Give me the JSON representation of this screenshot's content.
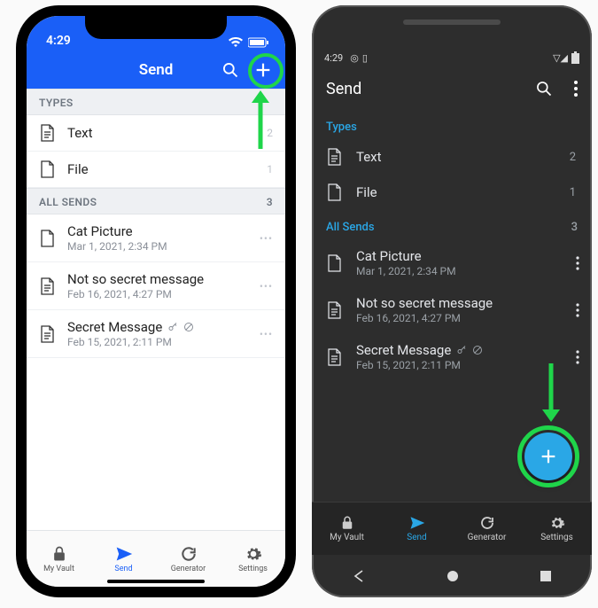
{
  "ios": {
    "statusbar": {
      "time": "4:29"
    },
    "navbar": {
      "title": "Send"
    },
    "sections": {
      "types": {
        "header": "TYPES",
        "items": [
          {
            "label": "Text",
            "count": "2"
          },
          {
            "label": "File",
            "count": "1"
          }
        ]
      },
      "all": {
        "header": "ALL SENDS",
        "count": "3",
        "items": [
          {
            "title": "Cat Picture",
            "sub": "Mar 1, 2021, 2:34 PM",
            "flags": []
          },
          {
            "title": "Not so secret message",
            "sub": "Feb 16, 2021, 4:27 PM",
            "flags": []
          },
          {
            "title": "Secret Message",
            "sub": "Feb 15, 2021, 2:11 PM",
            "flags": [
              "key",
              "disabled"
            ]
          }
        ]
      }
    },
    "tabbar": {
      "vault": "My Vault",
      "send": "Send",
      "generator": "Generator",
      "settings": "Settings"
    }
  },
  "android": {
    "statusbar": {
      "time": "4:29"
    },
    "appbar": {
      "title": "Send"
    },
    "sections": {
      "types": {
        "header": "Types",
        "items": [
          {
            "label": "Text",
            "count": "2"
          },
          {
            "label": "File",
            "count": "1"
          }
        ]
      },
      "all": {
        "header": "All Sends",
        "count": "3",
        "items": [
          {
            "title": "Cat Picture",
            "sub": "Mar 1, 2021, 2:34 PM",
            "flags": []
          },
          {
            "title": "Not so secret message",
            "sub": "Feb 16, 2021, 4:27 PM",
            "flags": []
          },
          {
            "title": "Secret Message",
            "sub": "Feb 15, 2021, 2:11 PM",
            "flags": [
              "key",
              "disabled"
            ]
          }
        ]
      }
    },
    "tabbar": {
      "vault": "My Vault",
      "send": "Send",
      "generator": "Generator",
      "settings": "Settings"
    }
  },
  "colors": {
    "ios_accent": "#1a5ff7",
    "android_accent": "#2aa7e6",
    "highlight": "#1fd54a"
  }
}
